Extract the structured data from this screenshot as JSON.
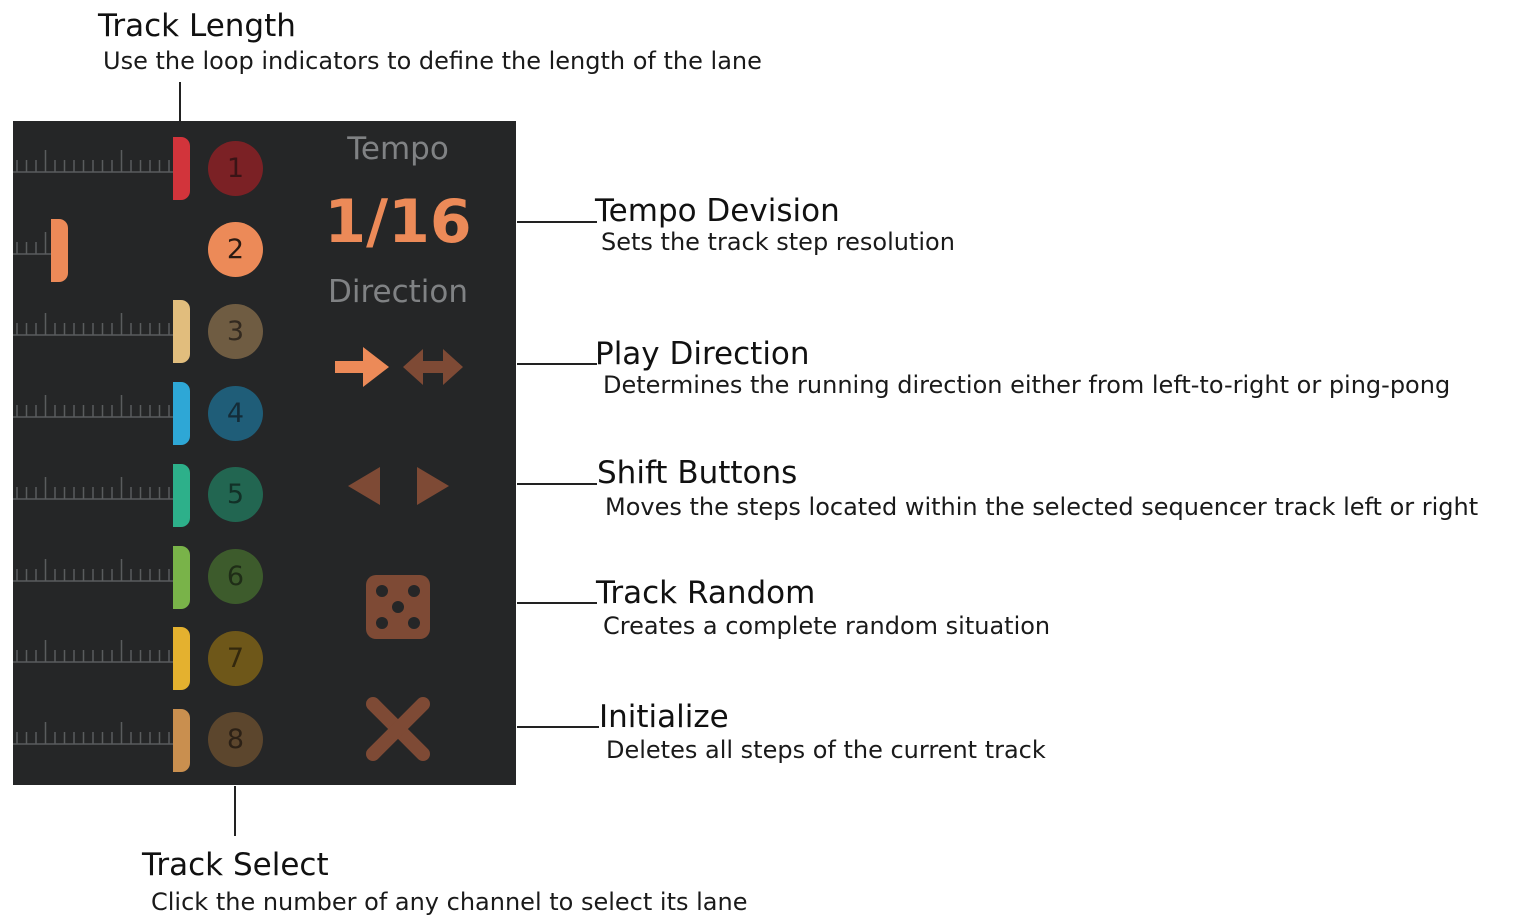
{
  "annotations": {
    "track_length": {
      "title": "Track Length",
      "desc": "Use the loop indicators to define the length of the lane"
    },
    "tempo_division": {
      "title": "Tempo Devision",
      "desc": "Sets the track step resolution"
    },
    "play_direction": {
      "title": "Play Direction",
      "desc": "Determines the running direction either from left-to-right or ping-pong"
    },
    "shift_buttons": {
      "title": "Shift Buttons",
      "desc": "Moves the steps located within the selected sequencer track left or right"
    },
    "track_random": {
      "title": "Track Random",
      "desc": "Creates a complete random situation"
    },
    "initialize": {
      "title": "Initialize",
      "desc": "Deletes all steps of the current track"
    },
    "track_select": {
      "title": "Track Select",
      "desc": "Click the number of any channel to select its lane"
    }
  },
  "panel": {
    "tempo_label": "Tempo",
    "tempo_value": "1/16",
    "direction_label": "Direction",
    "controls": {
      "direction_forward_icon": "arrow-right-icon",
      "direction_pingpong_icon": "arrow-left-right-icon",
      "shift_left_icon": "triangle-left-icon",
      "shift_right_icon": "triangle-right-icon",
      "random_icon": "dice-icon",
      "initialize_icon": "x-icon"
    },
    "tracks": [
      {
        "number": "1",
        "color": "#d2343b",
        "button_bg": "#7b2125",
        "text_color": "#3a1416",
        "selected": false
      },
      {
        "number": "2",
        "color": "#ec8a58",
        "button_bg": "#ec8a58",
        "text_color": "#2a1a12",
        "selected": true
      },
      {
        "number": "3",
        "color": "#e1bd7d",
        "button_bg": "#6f5c42",
        "text_color": "#332a20",
        "selected": false
      },
      {
        "number": "4",
        "color": "#2ea7d6",
        "button_bg": "#1f5d78",
        "text_color": "#142c38",
        "selected": false
      },
      {
        "number": "5",
        "color": "#2db08a",
        "button_bg": "#226651",
        "text_color": "#123127",
        "selected": false
      },
      {
        "number": "6",
        "color": "#79b349",
        "button_bg": "#3d5b2c",
        "text_color": "#1f2d17",
        "selected": false
      },
      {
        "number": "7",
        "color": "#e4b12f",
        "button_bg": "#6e5719",
        "text_color": "#33280d",
        "selected": false
      },
      {
        "number": "8",
        "color": "#c98f4f",
        "button_bg": "#5c462d",
        "text_color": "#2c2116",
        "selected": false
      }
    ]
  },
  "colors": {
    "panel_bg": "#252627",
    "accent": "#ec8a58",
    "dim_accent": "#7e4a35",
    "label_gray": "#808284",
    "ruler": "#5a5c5e"
  }
}
